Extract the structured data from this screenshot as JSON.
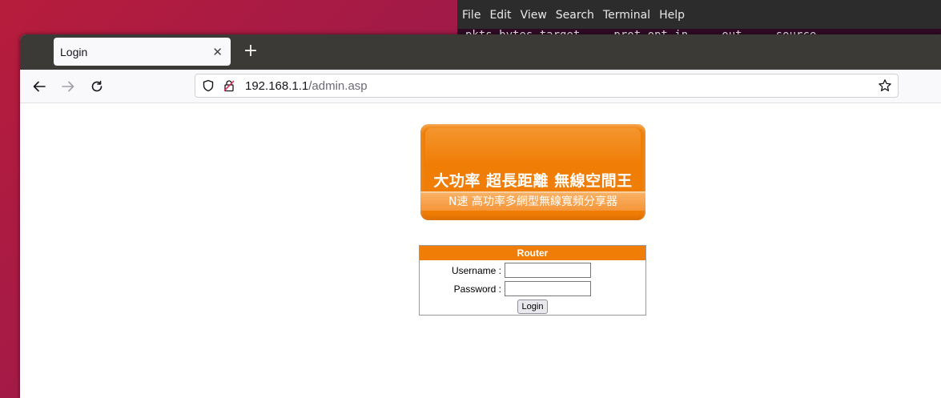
{
  "terminal": {
    "menu": [
      "File",
      "Edit",
      "View",
      "Search",
      "Terminal",
      "Help"
    ],
    "output_line": "pkts bytes target     prot opt in     out     source"
  },
  "browser": {
    "tab_title": "Login",
    "url_host": "192.168.1.1",
    "url_path": "/admin.asp"
  },
  "page": {
    "banner_main": "大功率  超長距離  無線空間王",
    "banner_sub": "N速 高功率多網型無線寬頻分享器",
    "login": {
      "header": "Router",
      "username_label": "Username :",
      "username_value": "",
      "password_label": "Password :",
      "password_value": "",
      "button_label": "Login"
    }
  },
  "colors": {
    "accent": "#f07d05",
    "desktop_bg": "#9e1a4a"
  }
}
